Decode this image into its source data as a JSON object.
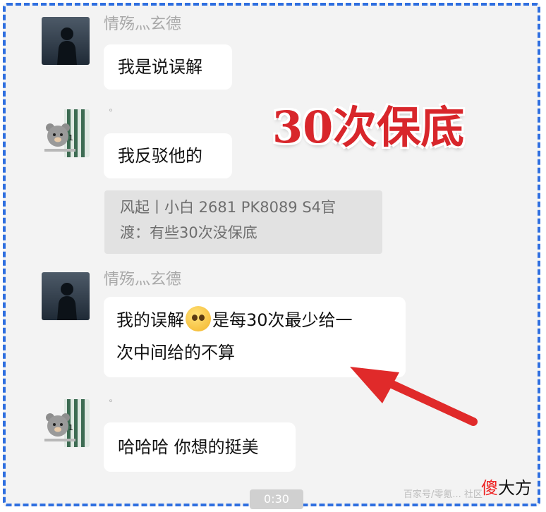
{
  "messages": [
    {
      "sender": "情殇灬玄德",
      "text": "我是说误解"
    },
    {
      "sender": "",
      "text": "我反驳他的"
    },
    {
      "quote": {
        "line1": "风起丨小白 2681 PK8089  S4官",
        "line2": "渡：有些30次没保底"
      }
    },
    {
      "sender": "情殇灬玄德",
      "text_before": "我的误解",
      "text_after": "是每30次最少给一",
      "text_line2": "次中间给的不算",
      "emoji": "worried-face-emoji"
    },
    {
      "sender": "",
      "text": "哈哈哈 你想的挺美"
    }
  ],
  "dot": "॰",
  "overlay_title": "30次保底",
  "arrow": {
    "color": "#e02a2a"
  },
  "video_time": "0:30",
  "watermark": {
    "small": "百家号/零氪... 社区",
    "first_char": "傻",
    "rest": "大方"
  },
  "colors": {
    "frame_border": "#2f6fe0",
    "overlay_text": "#d8262b"
  }
}
